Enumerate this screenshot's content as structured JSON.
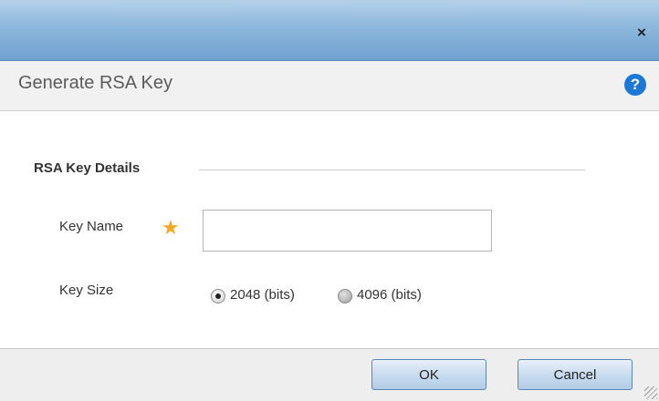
{
  "dialog": {
    "close_glyph": "×",
    "title": "Generate RSA Key",
    "help_glyph": "?"
  },
  "section": {
    "title": "RSA Key Details"
  },
  "key_name": {
    "label": "Key Name",
    "required_marker": "★",
    "value": "",
    "placeholder": ""
  },
  "key_size": {
    "label": "Key Size",
    "options": [
      {
        "label": "2048 (bits)",
        "selected": true
      },
      {
        "label": "4096 (bits)",
        "selected": false
      }
    ]
  },
  "footer": {
    "ok_label": "OK",
    "cancel_label": "Cancel"
  },
  "colors": {
    "titlebar": "#8db7dc",
    "help_icon": "#1b78d6",
    "required_star": "#f5a623"
  }
}
